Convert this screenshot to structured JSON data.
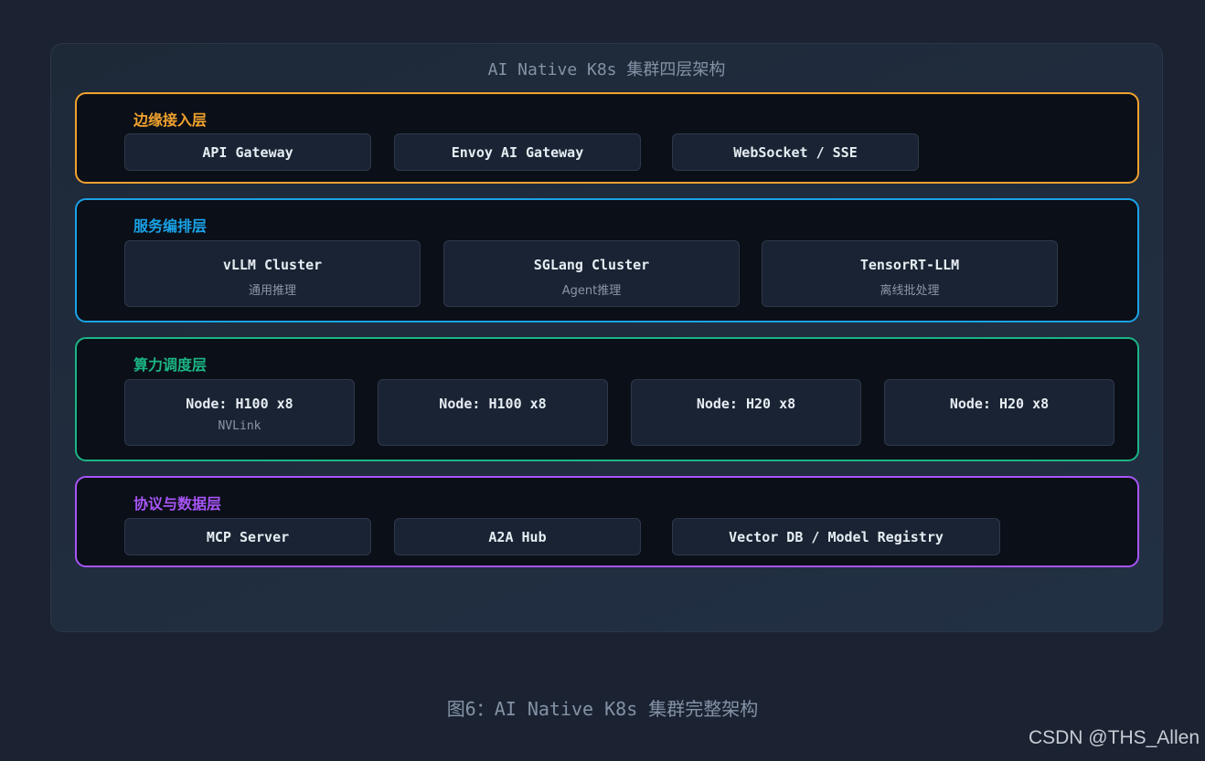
{
  "panel": {
    "title": "AI Native K8s 集群四层架构"
  },
  "layers": [
    {
      "title": "边缘接入层",
      "color": "#f0a22e",
      "items": [
        {
          "label": "API Gateway"
        },
        {
          "label": "Envoy AI Gateway"
        },
        {
          "label": "WebSocket / SSE"
        }
      ]
    },
    {
      "title": "服务编排层",
      "color": "#1aa3e8",
      "items": [
        {
          "label": "vLLM Cluster",
          "sub": "通用推理"
        },
        {
          "label": "SGLang Cluster",
          "sub": "Agent推理"
        },
        {
          "label": "TensorRT-LLM",
          "sub": "离线批处理"
        }
      ]
    },
    {
      "title": "算力调度层",
      "color": "#1bb585",
      "items": [
        {
          "label": "Node: H100 x8",
          "sub": "NVLink"
        },
        {
          "label": "Node: H100 x8"
        },
        {
          "label": "Node: H20 x8"
        },
        {
          "label": "Node: H20 x8"
        }
      ]
    },
    {
      "title": "协议与数据层",
      "color": "#a855f7",
      "items": [
        {
          "label": "MCP Server"
        },
        {
          "label": "A2A Hub"
        },
        {
          "label": "Vector DB / Model Registry"
        }
      ]
    }
  ],
  "caption": "图6：AI Native K8s 集群完整架构",
  "watermark": "CSDN @THS_Allen"
}
